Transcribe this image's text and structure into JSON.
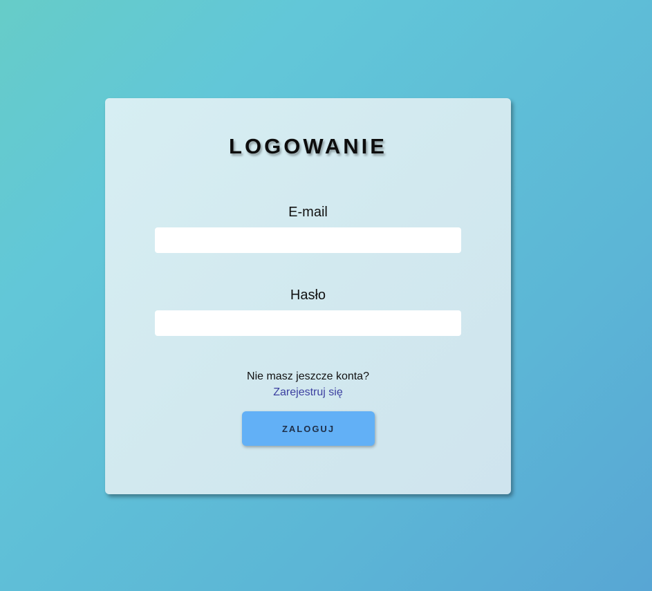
{
  "login_form": {
    "title": "LOGOWANIE",
    "email_label": "E-mail",
    "email_value": "",
    "password_label": "Hasło",
    "password_value": "",
    "no_account_text": "Nie masz jeszcze konta?",
    "register_link": "Zarejestruj się",
    "login_button": "ZALOGUJ"
  },
  "colors": {
    "background_start": "#66ccc8",
    "background_end": "#58a6d4",
    "card": "#d3eaf0",
    "button": "#62b0f6",
    "link": "#3b3fa0"
  }
}
